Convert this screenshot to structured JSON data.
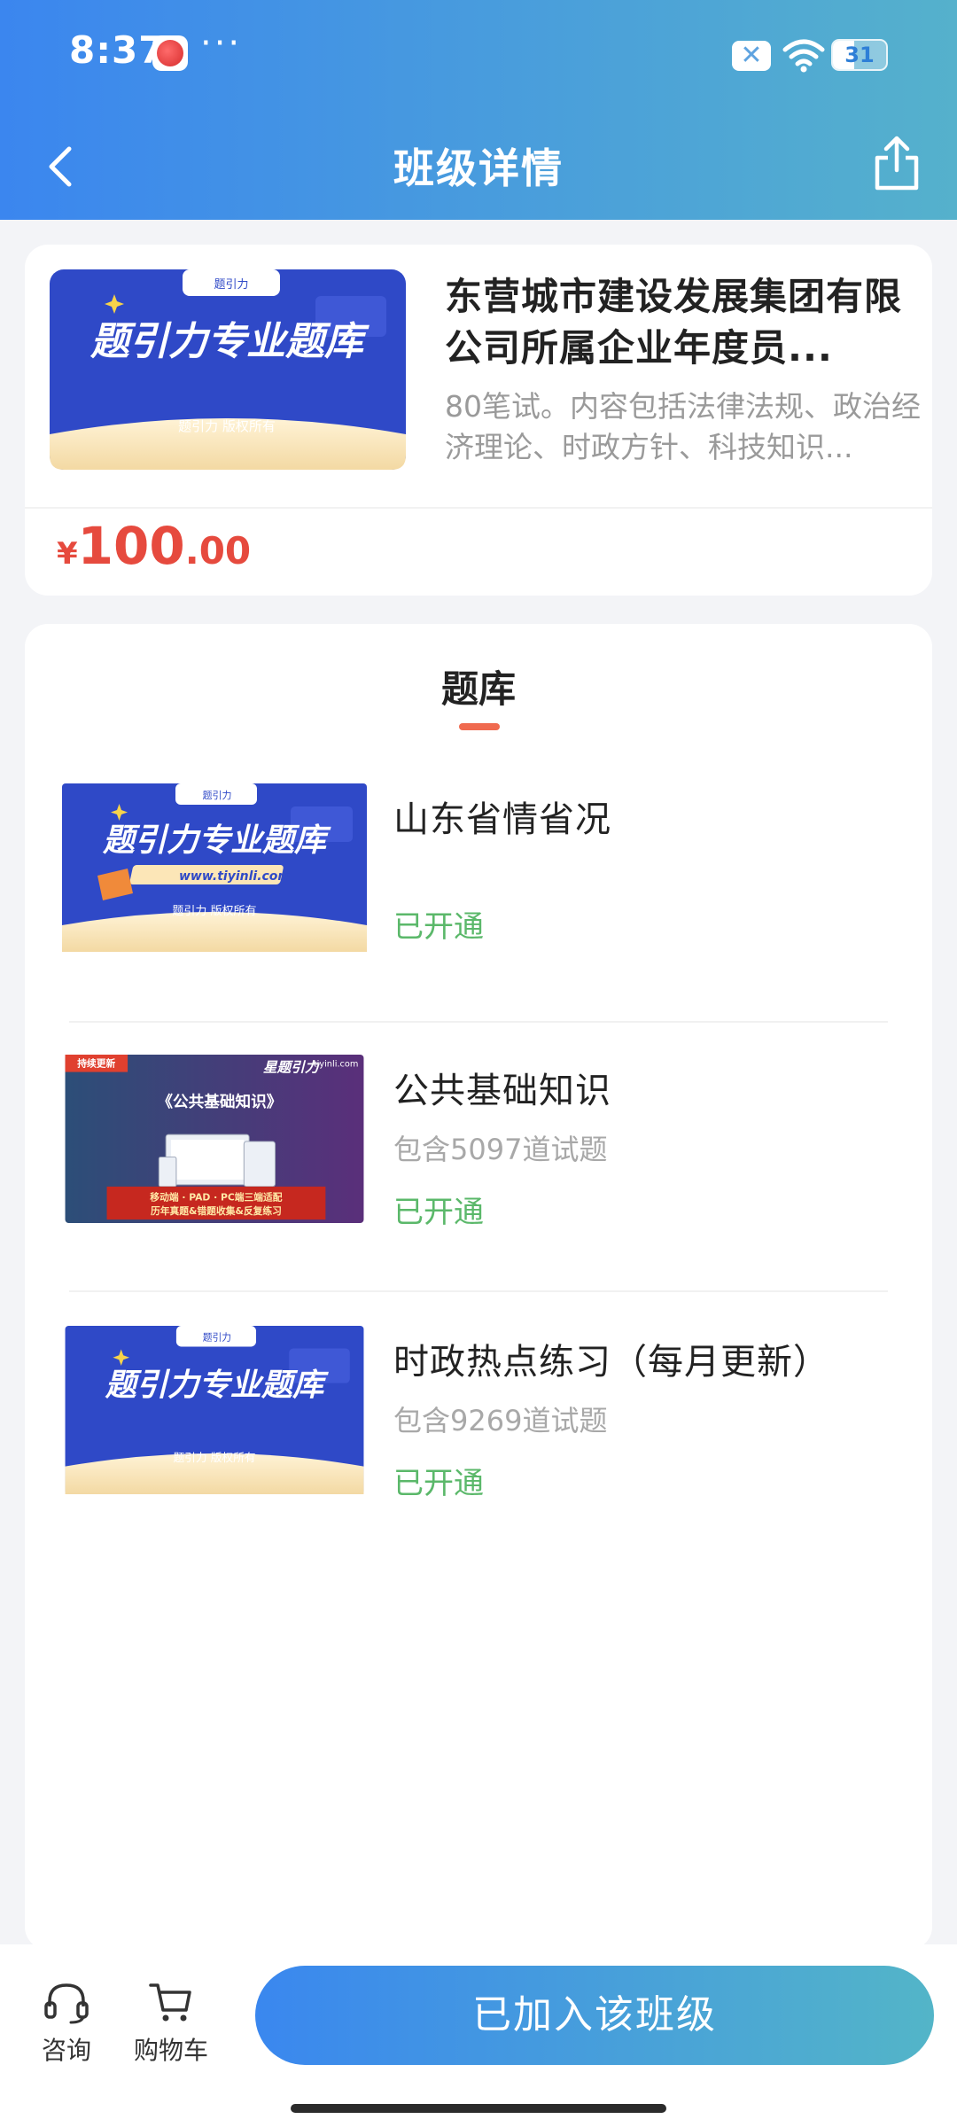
{
  "status_bar": {
    "time": "8:37",
    "more": "···",
    "battery_level": "31"
  },
  "nav": {
    "title": "班级详情"
  },
  "summary": {
    "title": "东营城市建设发展集团有限公司所属企业年度员...",
    "description": "80笔试。内容包括法律法规、政治经济理论、时政方针、科技知识...",
    "price": {
      "currency": "¥",
      "integer": "100",
      "decimal": ".00"
    },
    "thumb": {
      "brand": "题引力",
      "headline": "题引力专业题库",
      "footer": "题引力 版权所有"
    }
  },
  "bank": {
    "section_title": "题库",
    "items": [
      {
        "name": "山东省情省况",
        "count": "",
        "status": "已开通",
        "thumb": {
          "brand": "题引力",
          "headline": "题引力专业题库",
          "url": "www.tiyinli.com",
          "footer": "题引力 版权所有"
        }
      },
      {
        "name": "公共基础知识",
        "count": "包含5097道试题",
        "status": "已开通",
        "thumb": {
          "tag": "持续更新",
          "logo": "星题引力",
          "site": "tiyinli.com",
          "headline": "《公共基础知识》",
          "line1": "移动端 · PAD · PC端三端适配",
          "line2": "历年真题&错题收集&反复练习"
        }
      },
      {
        "name": "时政热点练习（每月更新）",
        "count": "包含9269道试题",
        "status": "已开通",
        "thumb": {
          "brand": "题引力",
          "headline": "题引力专业题库",
          "footer": "题引力 版权所有"
        }
      }
    ]
  },
  "bottom": {
    "consult_label": "咨询",
    "cart_label": "购物车",
    "join_label": "已加入该班级"
  }
}
